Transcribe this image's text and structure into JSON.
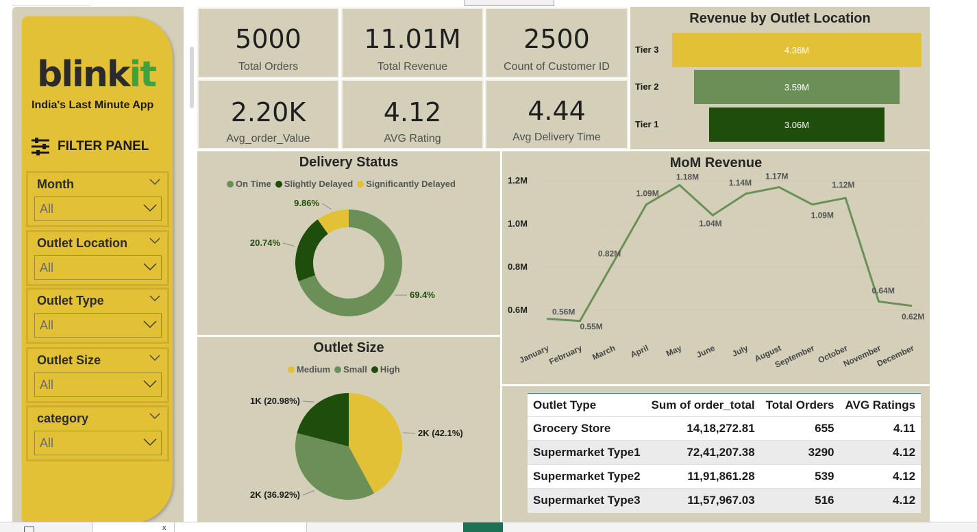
{
  "app": {
    "brand_main": "blink",
    "brand_accent": "it",
    "tagline": "India's Last Minute App"
  },
  "filter_panel": {
    "title": "FILTER PANEL",
    "slicers": [
      {
        "label": "Month",
        "value": "All"
      },
      {
        "label": "Outlet Location",
        "value": "All"
      },
      {
        "label": "Outlet Type",
        "value": "All"
      },
      {
        "label": "Outlet Size",
        "value": "All"
      },
      {
        "label": "category",
        "value": "All"
      }
    ]
  },
  "kpis": [
    {
      "value": "5000",
      "label": "Total Orders"
    },
    {
      "value": "11.01M",
      "label": "Total Revenue"
    },
    {
      "value": "2500",
      "label": "Count of Customer ID"
    },
    {
      "value": "2.20K",
      "label": "Avg_order_Value"
    },
    {
      "value": "4.12",
      "label": "AVG Rating"
    },
    {
      "value": "4.44",
      "label": "Avg Delivery Time"
    }
  ],
  "revenue_by_location": {
    "title": "Revenue by Outlet Location",
    "bars": [
      {
        "label": "Tier 3",
        "value": "4.36M",
        "amount": 4.36,
        "color": "#e2c136"
      },
      {
        "label": "Tier 2",
        "value": "3.59M",
        "amount": 3.59,
        "color": "#6a9058"
      },
      {
        "label": "Tier 1",
        "value": "3.06M",
        "amount": 3.06,
        "color": "#1f4d0b"
      }
    ]
  },
  "delivery_status": {
    "title": "Delivery Status",
    "legend": [
      {
        "name": "On Time",
        "color": "#6a9058"
      },
      {
        "name": "Slightly Delayed",
        "color": "#1f4d0b"
      },
      {
        "name": "Significantly Delayed",
        "color": "#e2c136"
      }
    ],
    "labels": {
      "on_time": "69.4%",
      "slightly": "20.74%",
      "significant": "9.86%"
    }
  },
  "outlet_size": {
    "title": "Outlet Size",
    "legend": [
      {
        "name": "Medium",
        "color": "#e2c136"
      },
      {
        "name": "Small",
        "color": "#6a9058"
      },
      {
        "name": "High",
        "color": "#1f4d0b"
      }
    ],
    "labels": {
      "medium": "2K (42.1%)",
      "small": "2K (36.92%)",
      "high": "1K (20.98%)"
    }
  },
  "mom_revenue": {
    "title": "MoM Revenue",
    "yticks": [
      "1.2M",
      "1.0M",
      "0.8M",
      "0.6M"
    ],
    "point_labels": [
      "0.56M",
      "0.55M",
      "0.82M",
      "1.09M",
      "1.18M",
      "1.04M",
      "1.14M",
      "1.17M",
      "1.09M",
      "1.12M",
      "0.64M",
      "0.62M"
    ]
  },
  "outlet_table": {
    "headers": [
      "Outlet Type",
      "Sum of order_total",
      "Total Orders",
      "AVG Ratings"
    ],
    "rows": [
      [
        "Grocery Store",
        "14,18,272.81",
        "655",
        "4.11"
      ],
      [
        "Supermarket Type1",
        "72,41,207.38",
        "3290",
        "4.12"
      ],
      [
        "Supermarket Type2",
        "11,91,861.28",
        "539",
        "4.12"
      ],
      [
        "Supermarket Type3",
        "11,57,967.03",
        "516",
        "4.12"
      ]
    ]
  },
  "chart_data": [
    {
      "type": "bar",
      "title": "Revenue by Outlet Location",
      "categories": [
        "Tier 3",
        "Tier 2",
        "Tier 1"
      ],
      "values": [
        4.36,
        3.59,
        3.06
      ],
      "unit": "M"
    },
    {
      "type": "pie",
      "title": "Delivery Status",
      "categories": [
        "On Time",
        "Slightly Delayed",
        "Significantly Delayed"
      ],
      "values": [
        69.4,
        20.74,
        9.86
      ],
      "unit": "%"
    },
    {
      "type": "pie",
      "title": "Outlet Size",
      "categories": [
        "Medium",
        "Small",
        "High"
      ],
      "values": [
        42.1,
        36.92,
        20.98
      ],
      "unit": "%"
    },
    {
      "type": "line",
      "title": "MoM Revenue",
      "categories": [
        "January",
        "February",
        "March",
        "April",
        "May",
        "June",
        "July",
        "August",
        "September",
        "October",
        "November",
        "December"
      ],
      "values": [
        0.56,
        0.55,
        0.82,
        1.09,
        1.18,
        1.04,
        1.14,
        1.17,
        1.09,
        1.12,
        0.64,
        0.62
      ],
      "ylim": [
        0.6,
        1.2
      ],
      "unit": "M",
      "color": "#6a9058"
    }
  ]
}
